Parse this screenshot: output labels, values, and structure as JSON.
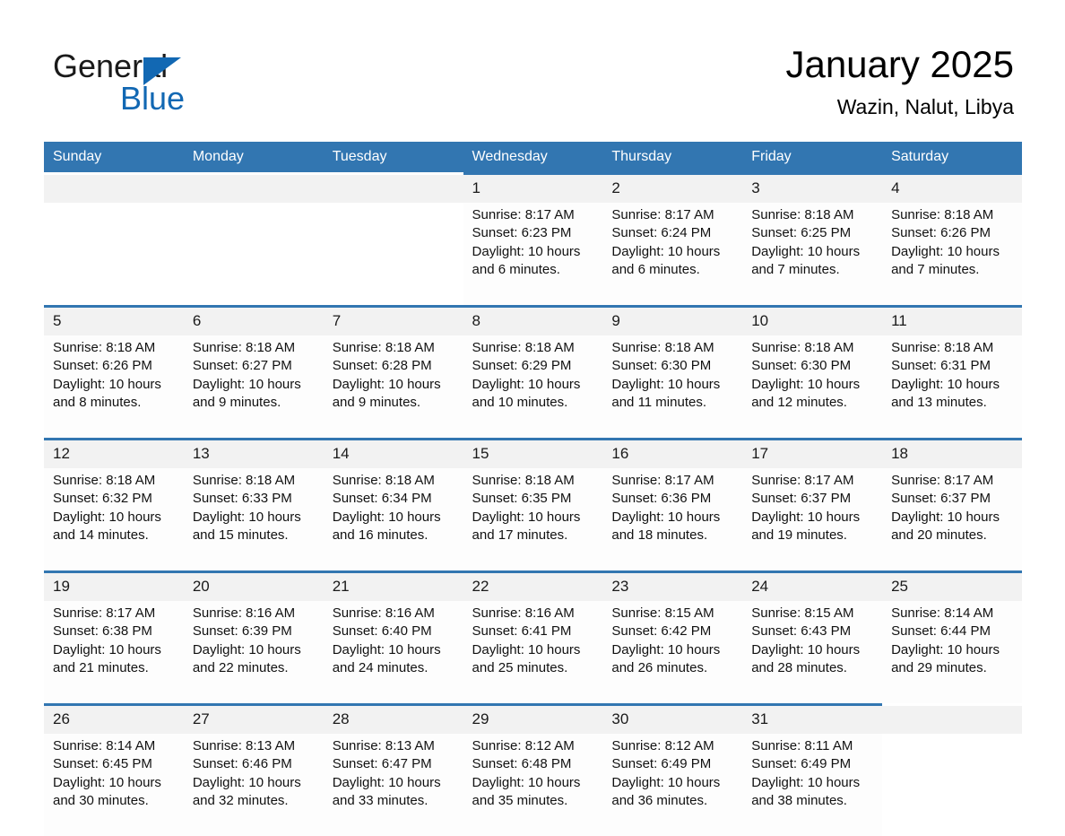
{
  "brand": {
    "name_part1": "General",
    "name_part2": "Blue",
    "logo_icon": "triangle-icon",
    "accent_color": "#1268b3"
  },
  "title": {
    "month_year": "January 2025",
    "location": "Wazin, Nalut, Libya"
  },
  "theme": {
    "header_blue": "#3276b1",
    "date_row_gray": "#f2f2f2",
    "cell_white": "#fdfdfd"
  },
  "calendar": {
    "weekday_headers": [
      "Sunday",
      "Monday",
      "Tuesday",
      "Wednesday",
      "Thursday",
      "Friday",
      "Saturday"
    ],
    "weeks": [
      [
        {
          "day": "",
          "empty": true
        },
        {
          "day": "",
          "empty": true
        },
        {
          "day": "",
          "empty": true
        },
        {
          "day": "1",
          "sunrise": "Sunrise: 8:17 AM",
          "sunset": "Sunset: 6:23 PM",
          "daylight_1": "Daylight: 10 hours",
          "daylight_2": "and 6 minutes."
        },
        {
          "day": "2",
          "sunrise": "Sunrise: 8:17 AM",
          "sunset": "Sunset: 6:24 PM",
          "daylight_1": "Daylight: 10 hours",
          "daylight_2": "and 6 minutes."
        },
        {
          "day": "3",
          "sunrise": "Sunrise: 8:18 AM",
          "sunset": "Sunset: 6:25 PM",
          "daylight_1": "Daylight: 10 hours",
          "daylight_2": "and 7 minutes."
        },
        {
          "day": "4",
          "sunrise": "Sunrise: 8:18 AM",
          "sunset": "Sunset: 6:26 PM",
          "daylight_1": "Daylight: 10 hours",
          "daylight_2": "and 7 minutes."
        }
      ],
      [
        {
          "day": "5",
          "sunrise": "Sunrise: 8:18 AM",
          "sunset": "Sunset: 6:26 PM",
          "daylight_1": "Daylight: 10 hours",
          "daylight_2": "and 8 minutes."
        },
        {
          "day": "6",
          "sunrise": "Sunrise: 8:18 AM",
          "sunset": "Sunset: 6:27 PM",
          "daylight_1": "Daylight: 10 hours",
          "daylight_2": "and 9 minutes."
        },
        {
          "day": "7",
          "sunrise": "Sunrise: 8:18 AM",
          "sunset": "Sunset: 6:28 PM",
          "daylight_1": "Daylight: 10 hours",
          "daylight_2": "and 9 minutes."
        },
        {
          "day": "8",
          "sunrise": "Sunrise: 8:18 AM",
          "sunset": "Sunset: 6:29 PM",
          "daylight_1": "Daylight: 10 hours",
          "daylight_2": "and 10 minutes."
        },
        {
          "day": "9",
          "sunrise": "Sunrise: 8:18 AM",
          "sunset": "Sunset: 6:30 PM",
          "daylight_1": "Daylight: 10 hours",
          "daylight_2": "and 11 minutes."
        },
        {
          "day": "10",
          "sunrise": "Sunrise: 8:18 AM",
          "sunset": "Sunset: 6:30 PM",
          "daylight_1": "Daylight: 10 hours",
          "daylight_2": "and 12 minutes."
        },
        {
          "day": "11",
          "sunrise": "Sunrise: 8:18 AM",
          "sunset": "Sunset: 6:31 PM",
          "daylight_1": "Daylight: 10 hours",
          "daylight_2": "and 13 minutes."
        }
      ],
      [
        {
          "day": "12",
          "sunrise": "Sunrise: 8:18 AM",
          "sunset": "Sunset: 6:32 PM",
          "daylight_1": "Daylight: 10 hours",
          "daylight_2": "and 14 minutes."
        },
        {
          "day": "13",
          "sunrise": "Sunrise: 8:18 AM",
          "sunset": "Sunset: 6:33 PM",
          "daylight_1": "Daylight: 10 hours",
          "daylight_2": "and 15 minutes."
        },
        {
          "day": "14",
          "sunrise": "Sunrise: 8:18 AM",
          "sunset": "Sunset: 6:34 PM",
          "daylight_1": "Daylight: 10 hours",
          "daylight_2": "and 16 minutes."
        },
        {
          "day": "15",
          "sunrise": "Sunrise: 8:18 AM",
          "sunset": "Sunset: 6:35 PM",
          "daylight_1": "Daylight: 10 hours",
          "daylight_2": "and 17 minutes."
        },
        {
          "day": "16",
          "sunrise": "Sunrise: 8:17 AM",
          "sunset": "Sunset: 6:36 PM",
          "daylight_1": "Daylight: 10 hours",
          "daylight_2": "and 18 minutes."
        },
        {
          "day": "17",
          "sunrise": "Sunrise: 8:17 AM",
          "sunset": "Sunset: 6:37 PM",
          "daylight_1": "Daylight: 10 hours",
          "daylight_2": "and 19 minutes."
        },
        {
          "day": "18",
          "sunrise": "Sunrise: 8:17 AM",
          "sunset": "Sunset: 6:37 PM",
          "daylight_1": "Daylight: 10 hours",
          "daylight_2": "and 20 minutes."
        }
      ],
      [
        {
          "day": "19",
          "sunrise": "Sunrise: 8:17 AM",
          "sunset": "Sunset: 6:38 PM",
          "daylight_1": "Daylight: 10 hours",
          "daylight_2": "and 21 minutes."
        },
        {
          "day": "20",
          "sunrise": "Sunrise: 8:16 AM",
          "sunset": "Sunset: 6:39 PM",
          "daylight_1": "Daylight: 10 hours",
          "daylight_2": "and 22 minutes."
        },
        {
          "day": "21",
          "sunrise": "Sunrise: 8:16 AM",
          "sunset": "Sunset: 6:40 PM",
          "daylight_1": "Daylight: 10 hours",
          "daylight_2": "and 24 minutes."
        },
        {
          "day": "22",
          "sunrise": "Sunrise: 8:16 AM",
          "sunset": "Sunset: 6:41 PM",
          "daylight_1": "Daylight: 10 hours",
          "daylight_2": "and 25 minutes."
        },
        {
          "day": "23",
          "sunrise": "Sunrise: 8:15 AM",
          "sunset": "Sunset: 6:42 PM",
          "daylight_1": "Daylight: 10 hours",
          "daylight_2": "and 26 minutes."
        },
        {
          "day": "24",
          "sunrise": "Sunrise: 8:15 AM",
          "sunset": "Sunset: 6:43 PM",
          "daylight_1": "Daylight: 10 hours",
          "daylight_2": "and 28 minutes."
        },
        {
          "day": "25",
          "sunrise": "Sunrise: 8:14 AM",
          "sunset": "Sunset: 6:44 PM",
          "daylight_1": "Daylight: 10 hours",
          "daylight_2": "and 29 minutes."
        }
      ],
      [
        {
          "day": "26",
          "sunrise": "Sunrise: 8:14 AM",
          "sunset": "Sunset: 6:45 PM",
          "daylight_1": "Daylight: 10 hours",
          "daylight_2": "and 30 minutes."
        },
        {
          "day": "27",
          "sunrise": "Sunrise: 8:13 AM",
          "sunset": "Sunset: 6:46 PM",
          "daylight_1": "Daylight: 10 hours",
          "daylight_2": "and 32 minutes."
        },
        {
          "day": "28",
          "sunrise": "Sunrise: 8:13 AM",
          "sunset": "Sunset: 6:47 PM",
          "daylight_1": "Daylight: 10 hours",
          "daylight_2": "and 33 minutes."
        },
        {
          "day": "29",
          "sunrise": "Sunrise: 8:12 AM",
          "sunset": "Sunset: 6:48 PM",
          "daylight_1": "Daylight: 10 hours",
          "daylight_2": "and 35 minutes."
        },
        {
          "day": "30",
          "sunrise": "Sunrise: 8:12 AM",
          "sunset": "Sunset: 6:49 PM",
          "daylight_1": "Daylight: 10 hours",
          "daylight_2": "and 36 minutes."
        },
        {
          "day": "31",
          "sunrise": "Sunrise: 8:11 AM",
          "sunset": "Sunset: 6:49 PM",
          "daylight_1": "Daylight: 10 hours",
          "daylight_2": "and 38 minutes."
        },
        {
          "day": "",
          "empty": true
        }
      ]
    ]
  }
}
